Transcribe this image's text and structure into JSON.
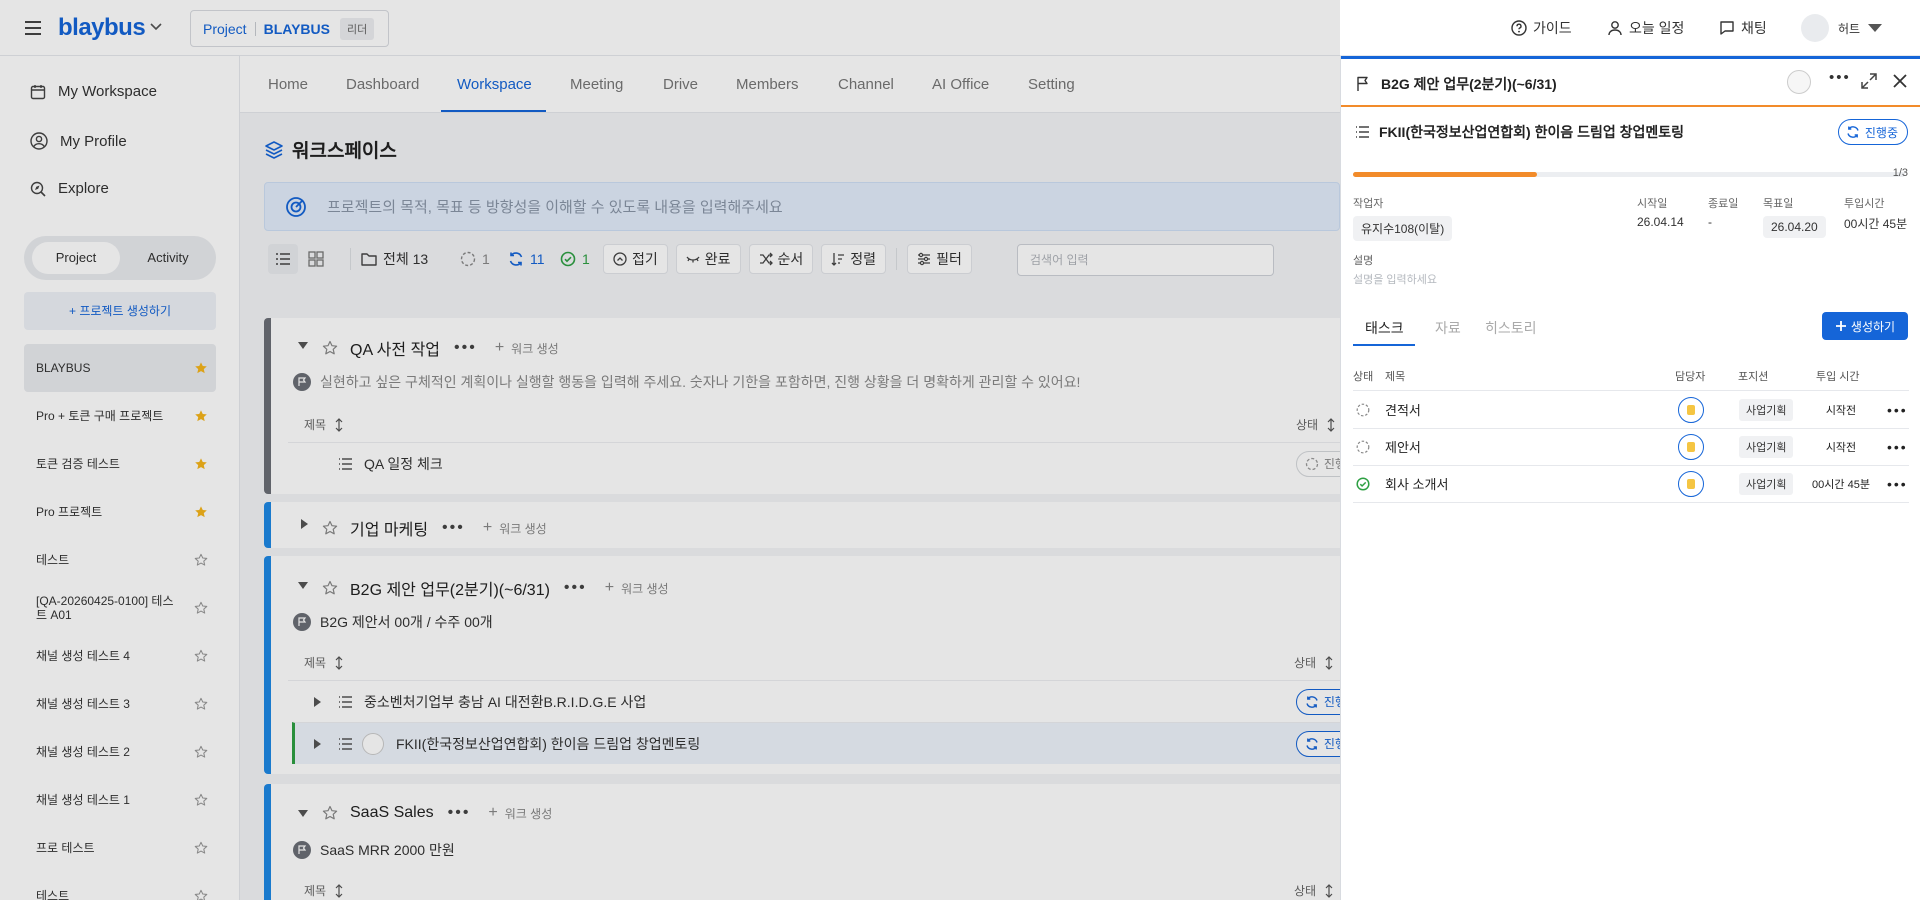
{
  "topbar": {
    "logo": "blaybus",
    "project_prefix": "Project",
    "project_name": "BLAYBUS",
    "role_badge": "리더",
    "guide": "가이드",
    "today": "오늘 일정",
    "chat": "채팅",
    "user": "허트"
  },
  "sidebar": {
    "nav": [
      "My Workspace",
      "My Profile",
      "Explore"
    ],
    "seg_project": "Project",
    "seg_activity": "Activity",
    "create_project": "+ 프로젝트 생성하기",
    "projects": [
      {
        "name": "BLAYBUS",
        "starred": true
      },
      {
        "name": "Pro + 토큰 구매 프로젝트",
        "starred": true
      },
      {
        "name": "토큰 검증 테스트",
        "starred": true
      },
      {
        "name": "Pro 프로젝트",
        "starred": true
      },
      {
        "name": "테스트",
        "starred": false
      },
      {
        "name": "[QA-20260425-0100] 테스트 A01",
        "starred": false
      },
      {
        "name": "채널 생성 테스트 4",
        "starred": false
      },
      {
        "name": "채널 생성 테스트 3",
        "starred": false
      },
      {
        "name": "채널 생성 테스트 2",
        "starred": false
      },
      {
        "name": "채널 생성 테스트 1",
        "starred": false
      },
      {
        "name": "프로 테스트",
        "starred": false
      },
      {
        "name": "테스트",
        "starred": false
      }
    ]
  },
  "tabs": [
    "Home",
    "Dashboard",
    "Workspace",
    "Meeting",
    "Drive",
    "Members",
    "Channel",
    "AI Office",
    "Setting"
  ],
  "workspace": {
    "title": "워크스페이스",
    "purpose_placeholder": "프로젝트의 목적, 목표 등 방향성을 이해할 수 있도록 내용을 입력해주세요",
    "filters": {
      "all": "전체 13",
      "todo": "1",
      "progress": "11",
      "done": "1",
      "collapse": "접기",
      "complete": "완료",
      "order": "순서",
      "sort": "정렬",
      "filter": "필터"
    },
    "search_placeholder": "검색어 입력"
  },
  "groups": [
    {
      "name": "QA 사전 작업",
      "add": "워크 생성",
      "desc": "실현하고 싶은 구체적인 계획이나 실행할 행동을 입력해 주세요. 숫자나 기한을 포함하면, 진행 상황을 더 명확하게 관리할 수 있어요!",
      "col_title": "제목",
      "col_status": "상태",
      "rows": [
        {
          "title": "QA 일정 체크",
          "status": "진행전"
        }
      ]
    },
    {
      "name": "기업 마케팅",
      "add": "워크 생성"
    },
    {
      "name": "B2G 제안 업무(2분기)(~6/31)",
      "add": "워크 생성",
      "desc": "B2G 제안서 00개 / 수주 00개",
      "col_title": "제목",
      "col_status": "상태",
      "rows": [
        {
          "title": "중소벤처기업부 충남 AI 대전환B.R.I.D.G.E 사업",
          "status": "진행중"
        },
        {
          "title": "FKII(한국정보산업연합회) 한이음 드림업 창업멘토링",
          "status": "진행중"
        }
      ]
    },
    {
      "name": "SaaS Sales",
      "add": "워크 생성",
      "desc": "SaaS MRR 2000 만원",
      "col_title": "제목",
      "col_status": "상태"
    }
  ],
  "panel": {
    "group_title": "B2G 제안 업무(2분기)(~6/31)",
    "work_title": "FKII(한국정보산업연합회) 한이음 드림업 창업멘토링",
    "status": "진행중",
    "progress": 0.3333,
    "progress_text": "1/3",
    "labels": {
      "author": "작업자",
      "start": "시작일",
      "end": "종료일",
      "target": "목표일",
      "time": "투입시간",
      "desc": "설명"
    },
    "author": "유지수108(이탈)",
    "start": "26.04.14",
    "end": "-",
    "target": "26.04.20",
    "time": "00시간 45분",
    "desc_placeholder": "설명을 입력하세요",
    "tabs": [
      "태스크",
      "자료",
      "히스토리"
    ],
    "new_button": "생성하기",
    "table_headers": {
      "status": "상태",
      "title": "제목",
      "assignee": "담당자",
      "position": "포지션",
      "time": "투입 시간"
    },
    "tasks": [
      {
        "title": "견적서",
        "position": "사업기획",
        "time": "시작전",
        "done": false
      },
      {
        "title": "제안서",
        "position": "사업기획",
        "time": "시작전",
        "done": false
      },
      {
        "title": "회사 소개서",
        "position": "사업기획",
        "time": "00시간 45분",
        "done": true
      }
    ]
  },
  "colors": {
    "brand": "#1565d8",
    "accent_orange": "#f28b2a",
    "success": "#2ea043"
  }
}
